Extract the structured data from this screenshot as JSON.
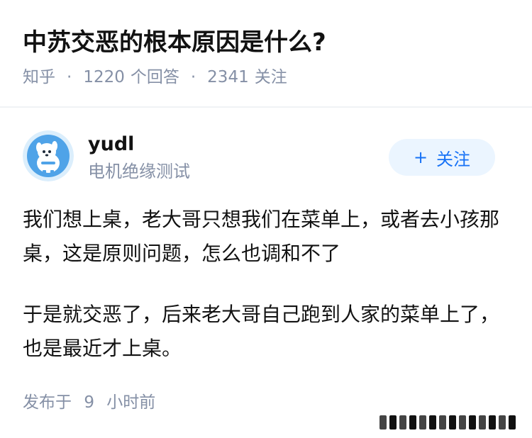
{
  "question": {
    "title": "中苏交恶的根本原因是什么?",
    "source": "知乎",
    "separator": "·",
    "answer_count": "1220",
    "answer_label": "个回答",
    "follower_count": "2341",
    "follower_label": "关注"
  },
  "answer": {
    "author": {
      "name": "yudl",
      "bio": "电机绝缘测试",
      "avatar_icon": "dog-avatar-icon"
    },
    "follow_button": {
      "icon": "+",
      "label": "关注"
    },
    "paragraphs": [
      "我们想上桌，老大哥只想我们在菜单上，或者去小孩那桌，这是原则问题，怎么也调和不了",
      "于是就交恶了，后来老大哥自己跑到人家的菜单上了，也是最近才上桌。"
    ],
    "publish": {
      "prefix": "发布于",
      "time_value": "9",
      "time_unit": "小时前"
    }
  },
  "colors": {
    "text_primary": "#121212",
    "text_secondary": "#8590a6",
    "accent_blue": "#1772f6",
    "follow_bg": "#ebf5ff",
    "avatar_bg": "#4fa3e8"
  }
}
